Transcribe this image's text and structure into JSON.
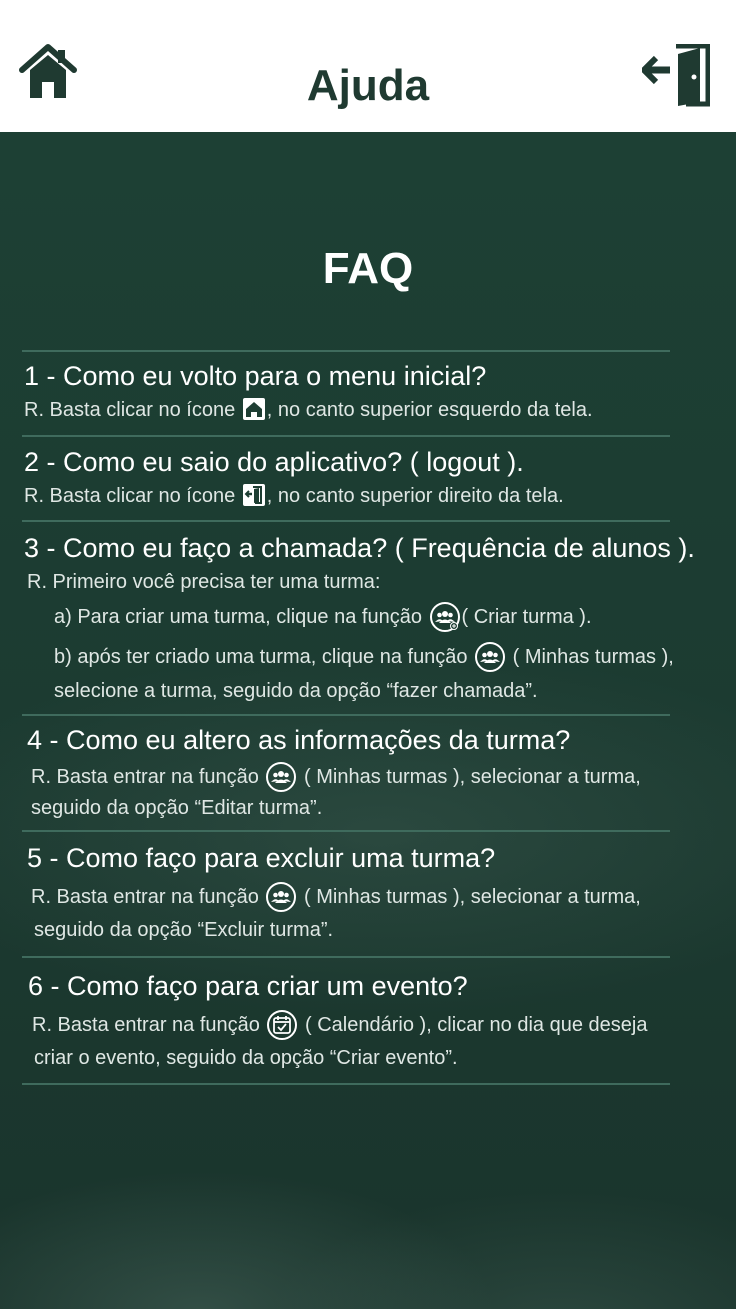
{
  "header": {
    "title": "Ajuda",
    "home_icon": "home-icon",
    "logout_icon": "logout-door-icon"
  },
  "faq": {
    "title": "FAQ",
    "items": [
      {
        "question": "1 - Como eu volto para o menu inicial?",
        "answer_pre": "R. Basta clicar no ícone ",
        "answer_post": ", no canto superior esquerdo da tela."
      },
      {
        "question": "2 - Como eu saio do aplicativo? ( logout ).",
        "answer_pre": "R. Basta clicar no ícone ",
        "answer_post": ", no canto superior direito da tela."
      },
      {
        "question": "3 - Como eu faço a chamada? ( Frequência de alunos ).",
        "answer_intro": "R. Primeiro você precisa ter uma turma:",
        "step_a_pre": "a) Para criar uma turma, clique na função ",
        "step_a_post": "( Criar turma ).",
        "step_b_pre": "b) após ter criado uma turma, clique na função ",
        "step_b_post": " ( Minhas turmas ),",
        "step_b_line2": "selecione a turma, seguido da opção “fazer chamada”."
      },
      {
        "question": "4 - Como eu altero as informações da turma?",
        "answer_pre": "R. Basta entrar na função ",
        "answer_post": " ( Minhas turmas ), selecionar a turma,",
        "answer_line2": "seguido da opção “Editar turma”."
      },
      {
        "question": "5 - Como faço para excluir uma turma?",
        "answer_pre": "R. Basta entrar na função ",
        "answer_post": " ( Minhas turmas ), selecionar a turma,",
        "answer_line2": "seguido da opção “Excluir turma”."
      },
      {
        "question": "6 - Como faço para criar um evento?",
        "answer_pre": "R. Basta entrar na função ",
        "answer_post": " ( Calendário ),  clicar no dia que deseja",
        "answer_line2": "criar o evento, seguido da opção “Criar evento”."
      }
    ]
  },
  "colors": {
    "header_bg": "#ffffff",
    "title_color": "#1f3a31",
    "body_bg": "#1e3e33",
    "divider": "#3f6b5d"
  }
}
